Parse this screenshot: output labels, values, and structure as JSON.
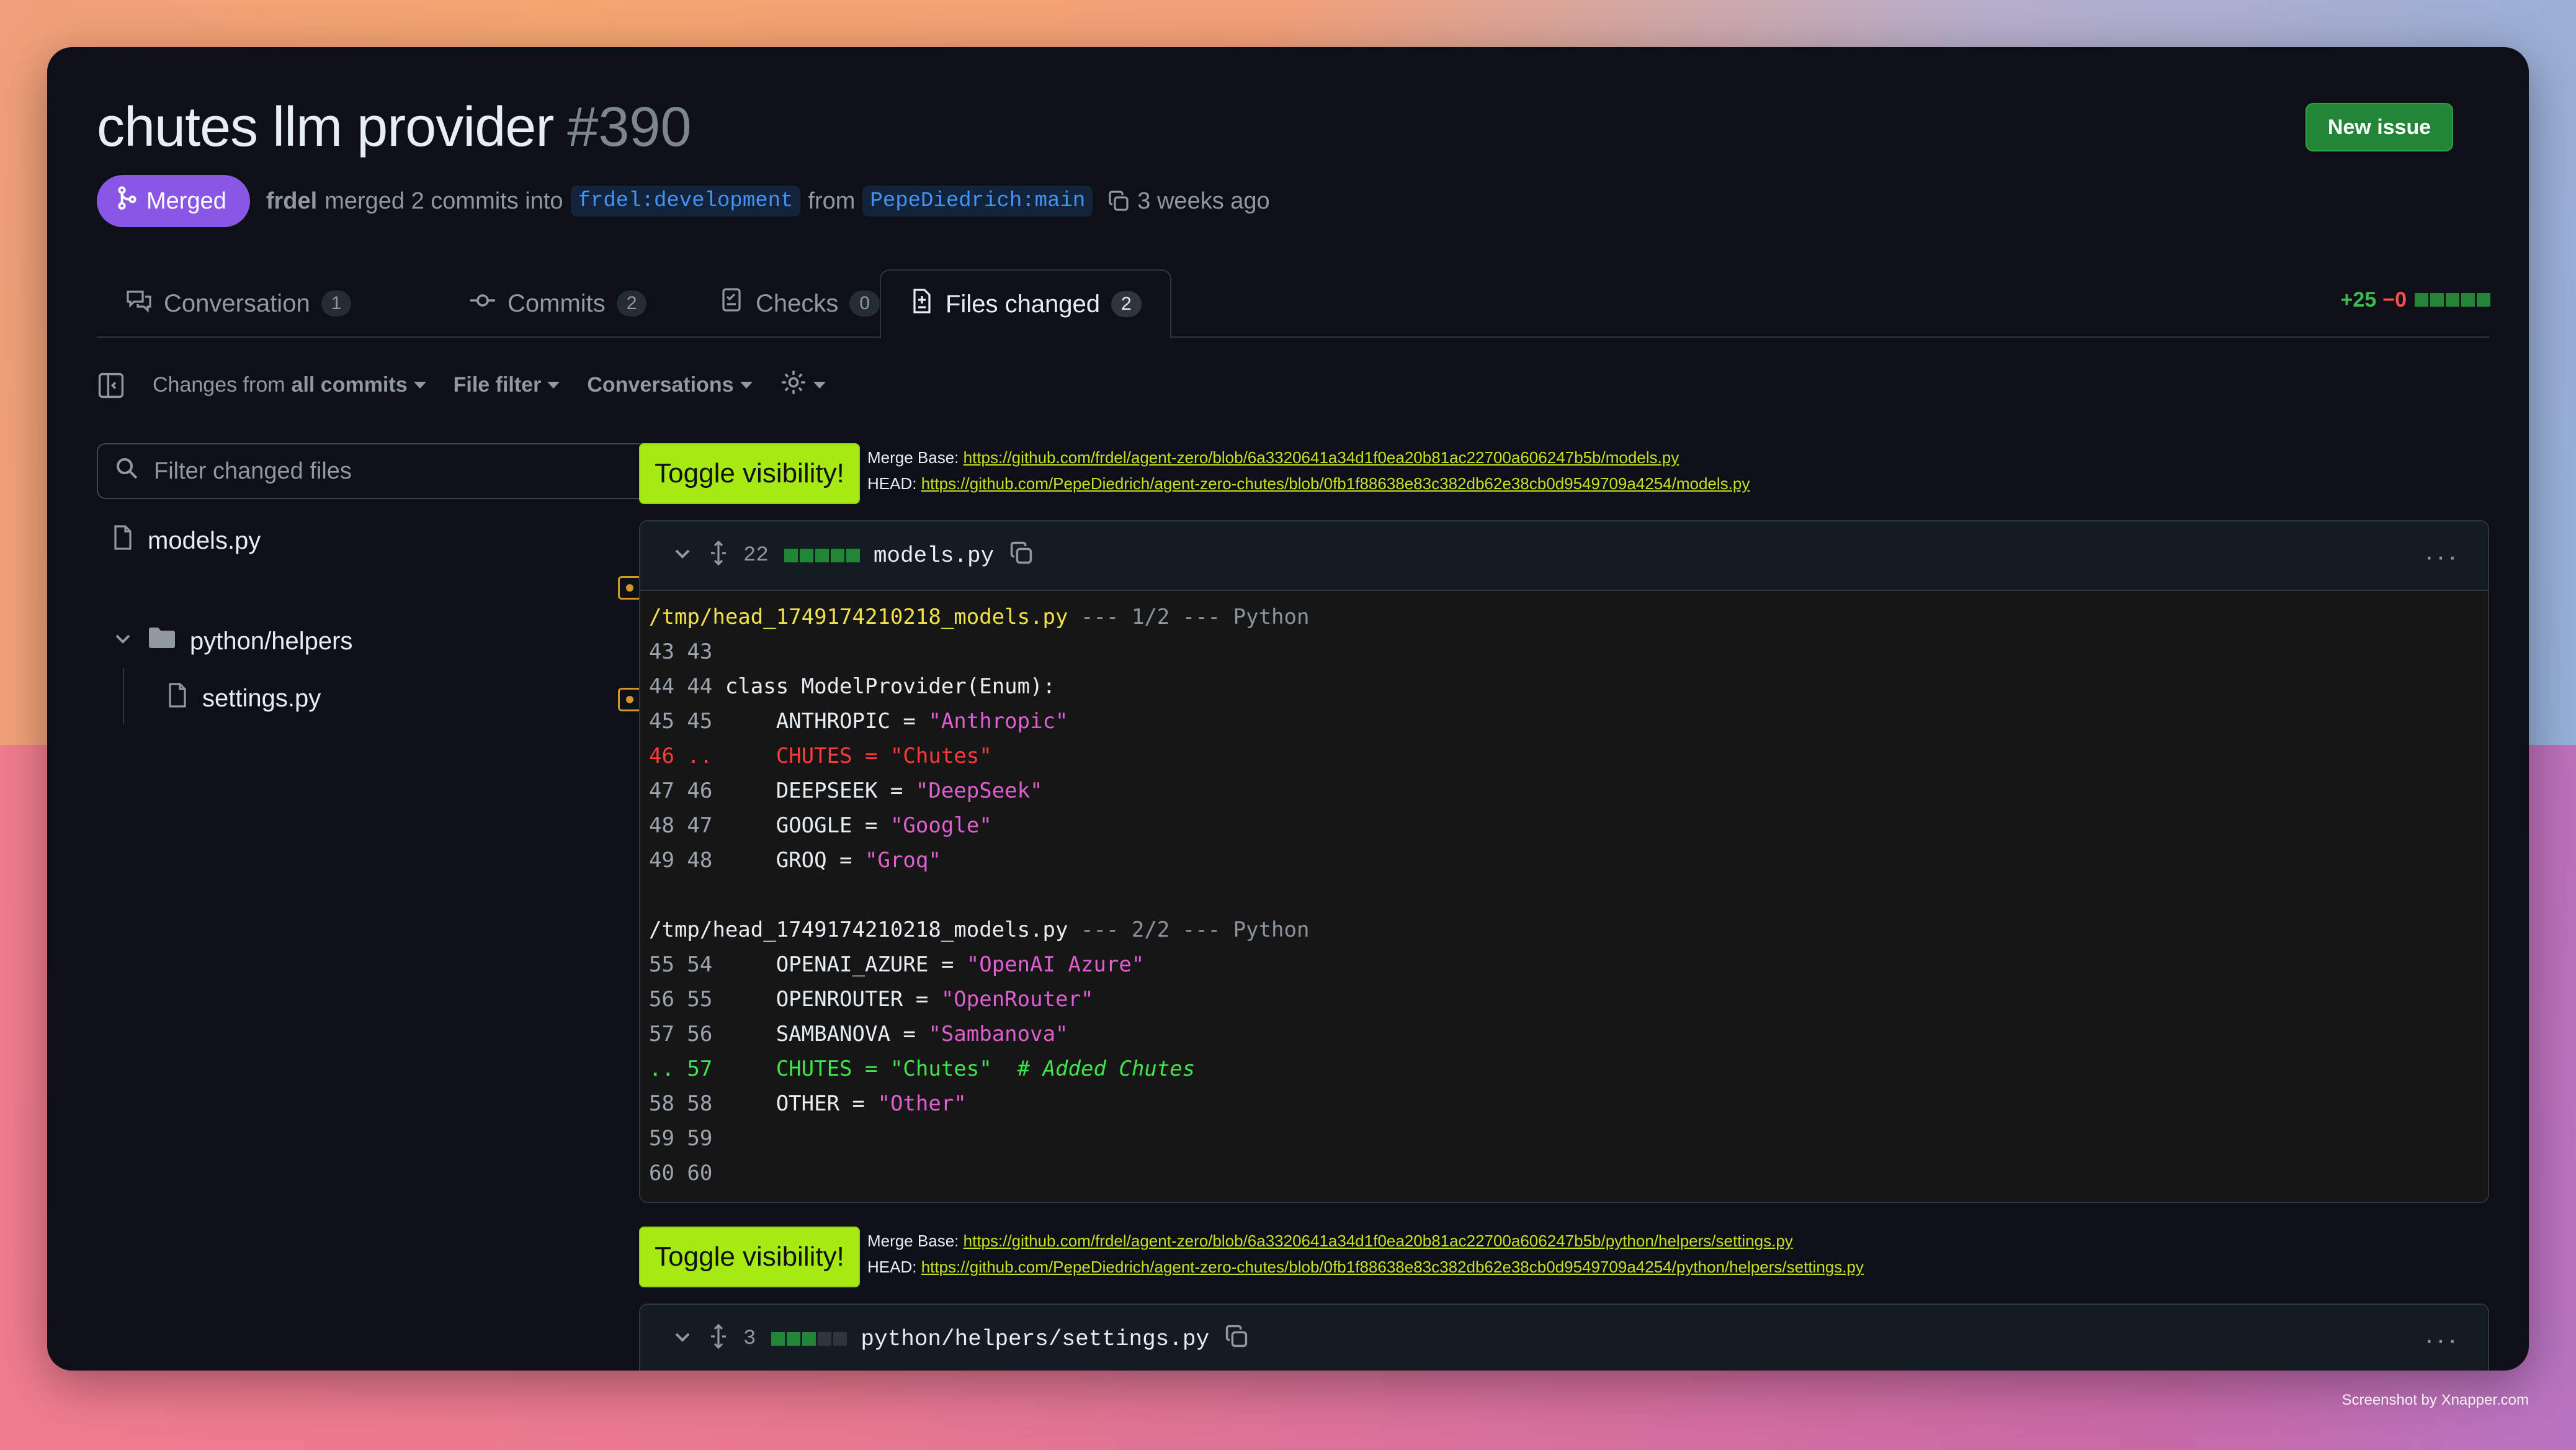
{
  "pr": {
    "title": "chutes llm provider",
    "number": "#390",
    "status": "Merged",
    "author": "frdel",
    "action_text": "merged 2 commits into",
    "base_branch": "frdel:development",
    "from_text": "from",
    "head_branch": "PepeDiedrich:main",
    "time_ago": "3 weeks ago"
  },
  "header": {
    "new_issue_label": "New issue"
  },
  "tabs": [
    {
      "label": "Conversation",
      "count": "1"
    },
    {
      "label": "Commits",
      "count": "2"
    },
    {
      "label": "Checks",
      "count": "0"
    },
    {
      "label": "Files changed",
      "count": "2"
    }
  ],
  "diffstat": {
    "additions": "+25",
    "deletions": "−0"
  },
  "toolbar": {
    "changes_from_prefix": "Changes from",
    "changes_from_value": "all commits",
    "file_filter": "File filter",
    "conversations": "Conversations"
  },
  "sidebar": {
    "filter_placeholder": "Filter changed files",
    "files": [
      {
        "name": "models.py"
      },
      {
        "name": "python/helpers"
      },
      {
        "name": "settings.py"
      }
    ]
  },
  "blocks": [
    {
      "toggle_label": "Toggle visibility!",
      "merge_base_label": "Merge Base:",
      "merge_base_url": "https://github.com/frdel/agent-zero/blob/6a3320641a34d1f0ea20b81ac22700a606247b5b/models.py",
      "head_label": "HEAD:",
      "head_url": "https://github.com/PepeDiedrich/agent-zero-chutes/blob/0fb1f88638e83c382db62e38cb0d9549709a4254/models.py"
    },
    {
      "toggle_label": "Toggle visibility!",
      "merge_base_label": "Merge Base:",
      "merge_base_url": "https://github.com/frdel/agent-zero/blob/6a3320641a34d1f0ea20b81ac22700a606247b5b/python/helpers/settings.py",
      "head_label": "HEAD:",
      "head_url": "https://github.com/PepeDiedrich/agent-zero-chutes/blob/0fb1f88638e83c382db62e38cb0d9549709a4254/python/helpers/settings.py"
    }
  ],
  "file1": {
    "changes": "22",
    "name": "models.py",
    "hunk1_path": "/tmp/head_1749174210218_models.py",
    "hunk1_info": " --- 1/2 --- Python",
    "hunk2_path": "/tmp/head_1749174210218_models.py",
    "hunk2_info": " --- 2/2 --- Python",
    "lines1": [
      {
        "ln": "43 43",
        "pre": "",
        "str": "",
        "post": ""
      },
      {
        "ln": "44 44",
        "pre": " class ModelProvider(Enum):",
        "str": "",
        "post": ""
      },
      {
        "ln": "45 45",
        "pre": "     ANTHROPIC = ",
        "str": "\"Anthropic\"",
        "post": ""
      },
      {
        "ln": "46 ..",
        "rm": "     CHUTES = \"Chutes\""
      },
      {
        "ln": "47 46",
        "pre": "     DEEPSEEK = ",
        "str": "\"DeepSeek\"",
        "post": ""
      },
      {
        "ln": "48 47",
        "pre": "     GOOGLE = ",
        "str": "\"Google\"",
        "post": ""
      },
      {
        "ln": "49 48",
        "pre": "     GROQ = ",
        "str": "\"Groq\"",
        "post": ""
      }
    ],
    "lines2": [
      {
        "ln": "55 54",
        "pre": "     OPENAI_AZURE = ",
        "str": "\"OpenAI Azure\"",
        "post": ""
      },
      {
        "ln": "56 55",
        "pre": "     OPENROUTER = ",
        "str": "\"OpenRouter\"",
        "post": ""
      },
      {
        "ln": "57 56",
        "pre": "     SAMBANOVA = ",
        "str": "\"Sambanova\"",
        "post": ""
      },
      {
        "ln": ".. 57",
        "add": "     CHUTES = \"Chutes\"",
        "comment": "  # Added Chutes"
      },
      {
        "ln": "58 58",
        "pre": "     OTHER = ",
        "str": "\"Other\"",
        "post": ""
      },
      {
        "ln": "59 59",
        "pre": "",
        "str": "",
        "post": ""
      },
      {
        "ln": "60 60",
        "pre": "",
        "str": "",
        "post": ""
      }
    ]
  },
  "file2": {
    "changes": "3",
    "name": "python/helpers/settings.py"
  },
  "colors": {
    "merged": "#8957e5",
    "toggle": "#a6ea14",
    "added": "#3fb950",
    "removed": "#f85149",
    "modified": "#d29922"
  },
  "watermark": "Screenshot by Xnapper.com"
}
